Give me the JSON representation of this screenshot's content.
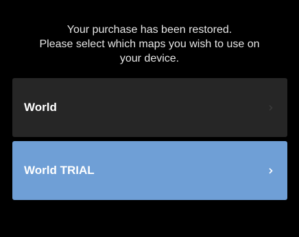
{
  "message": {
    "line1": "Your purchase has been restored.",
    "line2": "Please select which maps you wish to use on",
    "line3": "your device."
  },
  "options": [
    {
      "label": "World",
      "selected": false,
      "chevron_color": "#3a3a3a",
      "background": "#262626"
    },
    {
      "label": "World TRIAL",
      "selected": true,
      "chevron_color": "#ffffff",
      "background": "#6f9fd6"
    }
  ],
  "icons": {
    "row_arrow": "chevron-right-icon"
  }
}
